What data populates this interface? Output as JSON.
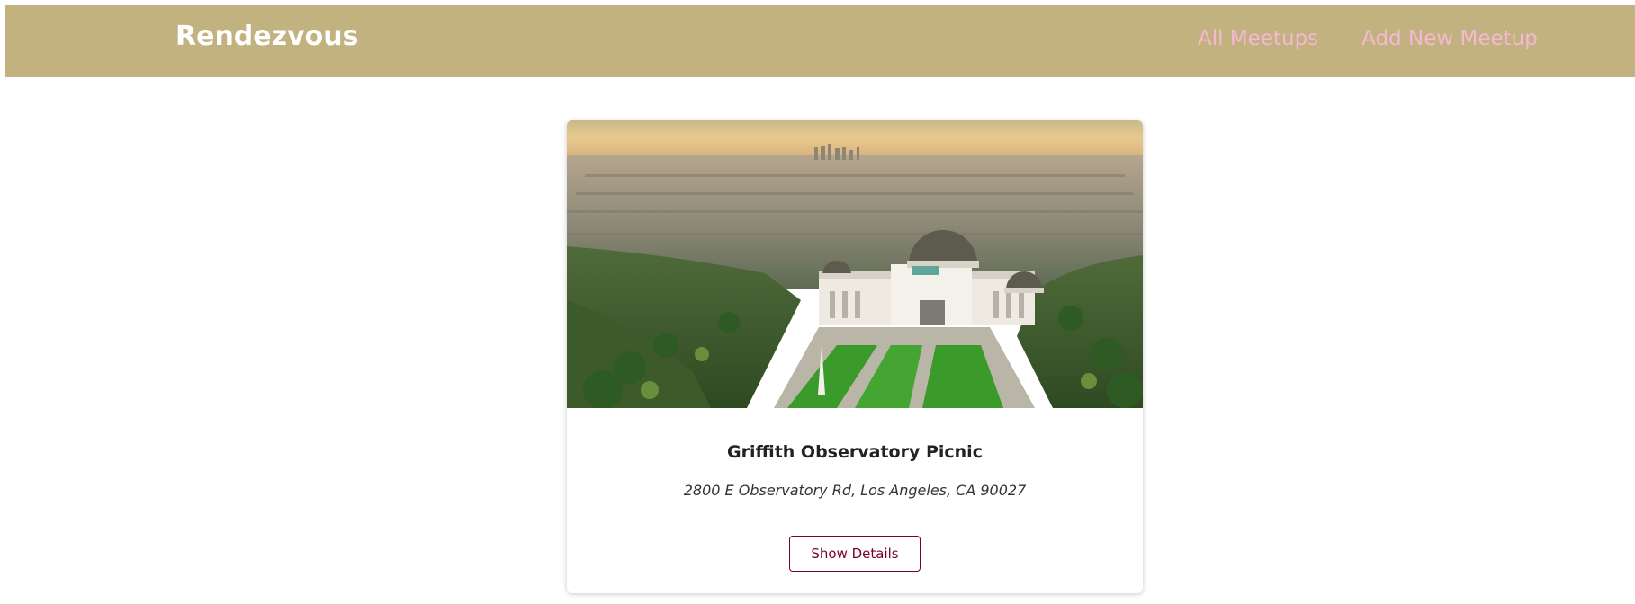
{
  "header": {
    "logo": "Rendezvous",
    "nav": {
      "all_meetups": "All Meetups",
      "add_new_meetup": "Add New Meetup"
    }
  },
  "meetup": {
    "title": "Griffith Observatory Picnic",
    "address": "2800 E Observatory Rd, Los Angeles, CA 90027",
    "details_label": "Show Details",
    "image_alt": "Griffith Observatory Picnic"
  },
  "colors": {
    "header_bg": "#c2b280",
    "logo_text": "#ffffff",
    "nav_link": "#f5b8d3",
    "button_accent": "#77002e"
  }
}
